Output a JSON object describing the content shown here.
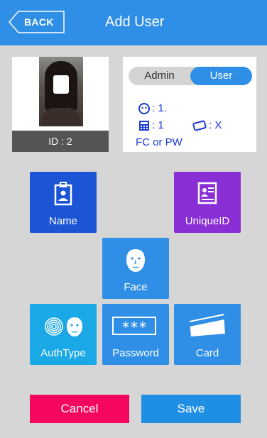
{
  "header": {
    "back_label": "BACK",
    "title": "Add User"
  },
  "user": {
    "id_label": "ID : 2"
  },
  "role_toggle": {
    "admin_label": "Admin",
    "user_label": "User",
    "selected": "User"
  },
  "info": {
    "face_value": ": 1.",
    "pin_value": ": 1",
    "card_value": ": X",
    "auth_mode": "FC or PW"
  },
  "tiles": {
    "name": "Name",
    "unique_id": "UniqueID",
    "face": "Face",
    "auth_type": "AuthType",
    "password": "Password",
    "card": "Card"
  },
  "password_mask": "***",
  "actions": {
    "cancel": "Cancel",
    "save": "Save"
  },
  "colors": {
    "header": "#2f8fe6",
    "tile_name": "#1b55d6",
    "tile_unique": "#8a2fd6",
    "tile_blue": "#2f8fe6",
    "tile_auth": "#1aa8e6",
    "cancel": "#f5075f",
    "save": "#1f8fe6"
  }
}
